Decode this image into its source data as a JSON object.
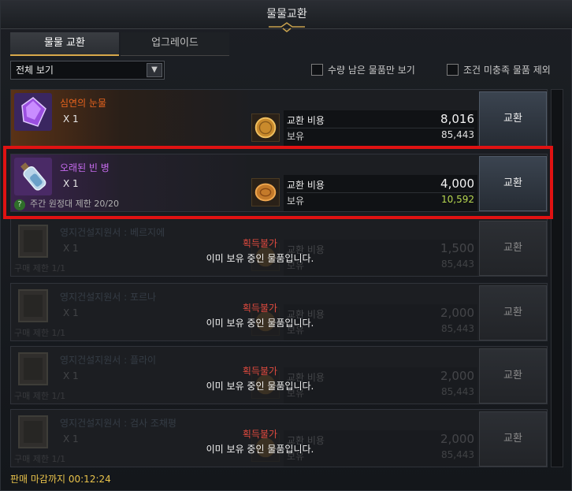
{
  "window": {
    "title": "물물교환"
  },
  "tabs": [
    {
      "label": "물물 교환",
      "active": true
    },
    {
      "label": "업그레이드",
      "active": false
    }
  ],
  "filters": {
    "select_value": "전체 보기",
    "check1": "수량 남은 물품만 보기",
    "check2": "조건 미충족 물품 제외"
  },
  "rows": [
    {
      "name": "심연의 눈물",
      "name_color": "#e8641e",
      "qty": "X 1",
      "limit": "",
      "cost_label": "교환 비용",
      "cost": "8,016",
      "owned_label": "보유",
      "owned": "85,443",
      "owned_color": "#e0e0e0",
      "button": "교환",
      "icon": "purple-gem-icon"
    },
    {
      "name": "오래된 빈 병",
      "name_color": "#c86cf0",
      "qty": "X 1",
      "limit": "주간 원정대 제한 20/20",
      "cost_label": "교환 비용",
      "cost": "4,000",
      "owned_label": "보유",
      "owned": "10,592",
      "owned_color": "#b8d850",
      "button": "교환",
      "icon": "bottle-icon"
    },
    {
      "name": "영지건설지원서 : 베르지에",
      "qty": "X 1",
      "limit": "구매 제한 1/1",
      "cost_label": "교환 비용",
      "cost": "1,500",
      "owned_label": "보유",
      "owned": "85,443",
      "button": "교환",
      "unavailable": "획득불가",
      "reason": "이미 보유 중인 물품입니다.",
      "icon": "book-icon"
    },
    {
      "name": "영지건설지원서 : 포르나",
      "qty": "X 1",
      "limit": "구매 제한 1/1",
      "cost_label": "교환 비용",
      "cost": "2,000",
      "owned_label": "보유",
      "owned": "85,443",
      "button": "교환",
      "unavailable": "획득불가",
      "reason": "이미 보유 중인 물품입니다.",
      "icon": "book-icon"
    },
    {
      "name": "영지건설지원서 : 플라이",
      "qty": "X 1",
      "limit": "구매 제한 1/1",
      "cost_label": "교환 비용",
      "cost": "2,000",
      "owned_label": "보유",
      "owned": "85,443",
      "button": "교환",
      "unavailable": "획득불가",
      "reason": "이미 보유 중인 물품입니다.",
      "icon": "book-icon"
    },
    {
      "name": "영지건설지원서 : 검사 조채평",
      "qty": "X 1",
      "limit": "구매 제한 1/1",
      "cost_label": "교환 비용",
      "cost": "2,000",
      "owned_label": "보유",
      "owned": "85,443",
      "button": "교환",
      "unavailable": "획득불가",
      "reason": "이미 보유 중인 물품입니다.",
      "icon": "book-icon"
    }
  ],
  "footer": {
    "deadline": "판매 마감까지 00:12:24"
  }
}
